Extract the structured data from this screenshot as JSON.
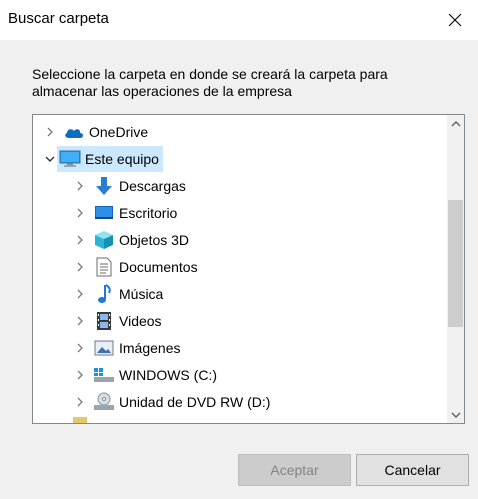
{
  "dialog": {
    "title": "Buscar carpeta",
    "instruction": "Seleccione la carpeta en donde se creará la carpeta para almacenar las operaciones de la empresa"
  },
  "tree": {
    "items": [
      {
        "label": "OneDrive",
        "icon": "cloud-icon",
        "level": 0,
        "expanded": false,
        "selected": false
      },
      {
        "label": "Este equipo",
        "icon": "computer-icon",
        "level": 0,
        "expanded": true,
        "selected": true
      },
      {
        "label": "Descargas",
        "icon": "download-arrow-icon",
        "level": 1,
        "expanded": false,
        "selected": false
      },
      {
        "label": "Escritorio",
        "icon": "desktop-icon",
        "level": 1,
        "expanded": false,
        "selected": false
      },
      {
        "label": "Objetos 3D",
        "icon": "cube-3d-icon",
        "level": 1,
        "expanded": false,
        "selected": false
      },
      {
        "label": "Documentos",
        "icon": "document-icon",
        "level": 1,
        "expanded": false,
        "selected": false
      },
      {
        "label": "Música",
        "icon": "music-note-icon",
        "level": 1,
        "expanded": false,
        "selected": false
      },
      {
        "label": "Videos",
        "icon": "film-icon",
        "level": 1,
        "expanded": false,
        "selected": false
      },
      {
        "label": "Imágenes",
        "icon": "picture-icon",
        "level": 1,
        "expanded": false,
        "selected": false
      },
      {
        "label": "WINDOWS (C:)",
        "icon": "drive-icon",
        "level": 1,
        "expanded": false,
        "selected": false
      },
      {
        "label": "Unidad de DVD RW (D:)",
        "icon": "dvd-drive-icon",
        "level": 1,
        "expanded": false,
        "selected": false
      }
    ]
  },
  "buttons": {
    "accept": "Aceptar",
    "cancel": "Cancelar"
  },
  "colors": {
    "selection": "#cce8ff",
    "onedrive": "#0f6cbd",
    "download": "#2b7cd3"
  }
}
